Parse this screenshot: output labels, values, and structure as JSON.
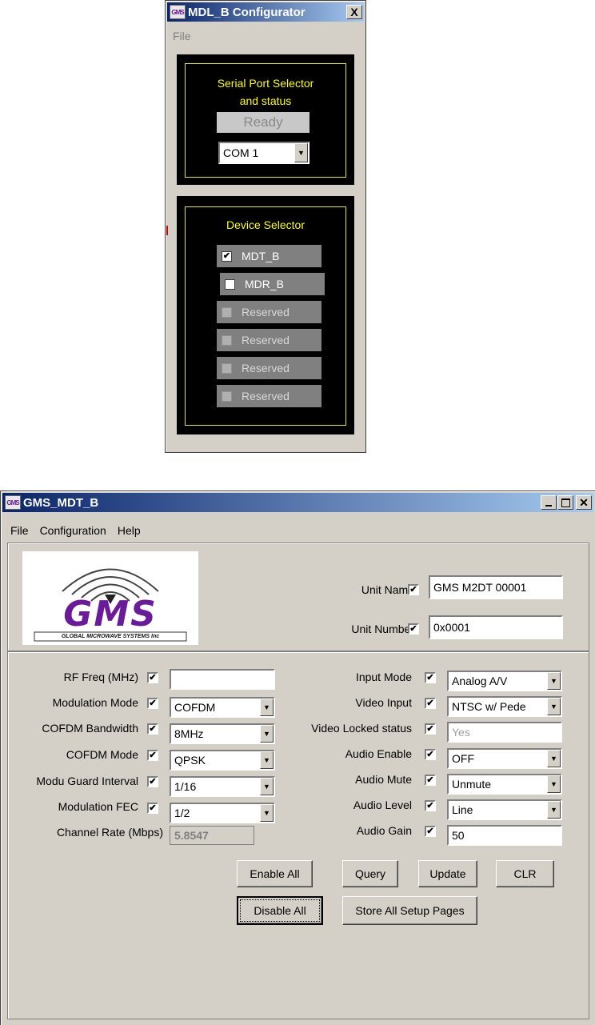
{
  "configurator": {
    "title": "MDL_B Configurator",
    "close_glyph": "X",
    "menu": [
      "File"
    ],
    "serial": {
      "title_line1": "Serial Port Selector",
      "title_line2": "and status",
      "status": "Ready",
      "port": "COM 1"
    },
    "device": {
      "title": "Device Selector",
      "items": [
        {
          "label": "MDT_B",
          "checked": true,
          "enabled": true
        },
        {
          "label": "MDR_B",
          "checked": false,
          "enabled": true
        },
        {
          "label": "Reserved",
          "checked": false,
          "enabled": false
        },
        {
          "label": "Reserved",
          "checked": false,
          "enabled": false
        },
        {
          "label": "Reserved",
          "checked": false,
          "enabled": false
        },
        {
          "label": "Reserved",
          "checked": false,
          "enabled": false
        }
      ]
    }
  },
  "mdt": {
    "title": "GMS_MDT_B",
    "icon_text": "GMS",
    "menu": [
      "File",
      "Configuration",
      "Help"
    ],
    "logo": {
      "brand": "GMS",
      "tagline": "GLOBAL MICROWAVE SYSTEMS Inc"
    },
    "unit_name": {
      "label": "Unit Name",
      "value": "GMS M2DT 00001"
    },
    "unit_number": {
      "label": "Unit Number",
      "value": "0x0001"
    },
    "left_fields": [
      {
        "label": "RF Freq (MHz)",
        "value": "",
        "kind": "text"
      },
      {
        "label": "Modulation Mode",
        "value": "COFDM",
        "kind": "combo"
      },
      {
        "label": "COFDM Bandwidth",
        "value": "8MHz",
        "kind": "combo"
      },
      {
        "label": "COFDM Mode",
        "value": "QPSK",
        "kind": "combo"
      },
      {
        "label": "Modu Guard Interval",
        "value": "1/16",
        "kind": "combo"
      },
      {
        "label": "Modulation FEC",
        "value": "1/2",
        "kind": "combo"
      }
    ],
    "channel_rate": {
      "label": "Channel Rate (Mbps)",
      "value": "5.8547"
    },
    "right_fields": [
      {
        "label": "Input Mode",
        "value": "Analog A/V",
        "kind": "combo"
      },
      {
        "label": "Video Input",
        "value": "NTSC w/ Pede",
        "kind": "combo"
      },
      {
        "label": "Video Locked status",
        "value": "Yes",
        "kind": "readonly"
      },
      {
        "label": "Audio Enable",
        "value": "OFF",
        "kind": "combo"
      },
      {
        "label": "Audio Mute",
        "value": "Unmute",
        "kind": "combo"
      },
      {
        "label": "Audio Level",
        "value": "Line",
        "kind": "combo"
      },
      {
        "label": "Audio Gain",
        "value": "50",
        "kind": "text"
      }
    ],
    "buttons": {
      "enable_all": "Enable All",
      "query": "Query",
      "update": "Update",
      "clr": "CLR",
      "disable_all": "Disable All",
      "store_all": "Store All Setup Pages"
    }
  }
}
